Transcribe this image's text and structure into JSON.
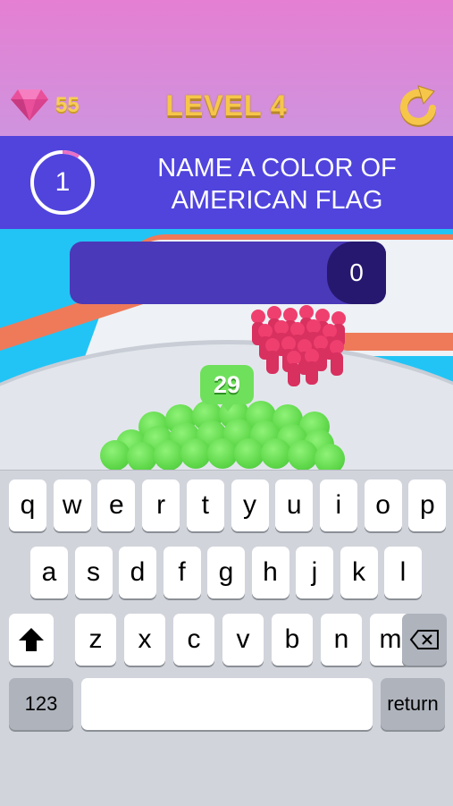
{
  "hud": {
    "gems": "55",
    "gem_icon": "diamond-gem-icon",
    "level": "LEVEL 4",
    "restart_icon": "restart-arrow-icon"
  },
  "question": {
    "timer": "1",
    "text_line1": "NAME A COLOR OF",
    "text_line2": "AMERICAN FLAG"
  },
  "answer": {
    "value": "",
    "count": "0"
  },
  "crowd": {
    "count": "29"
  },
  "keyboard": {
    "row1": [
      "q",
      "w",
      "e",
      "r",
      "t",
      "y",
      "u",
      "i",
      "o",
      "p"
    ],
    "row2": [
      "a",
      "s",
      "d",
      "f",
      "g",
      "h",
      "j",
      "k",
      "l"
    ],
    "row3": [
      "z",
      "x",
      "c",
      "v",
      "b",
      "n",
      "m"
    ],
    "shift_icon": "shift-arrow-icon",
    "delete_icon": "backspace-icon",
    "numbers_label": "123",
    "return_label": "return"
  },
  "colors": {
    "banner": "#5044dd",
    "answer_box": "#4a39b8",
    "player": "#5fd84a",
    "enemy": "#ef3f6f",
    "gold": "#f6c64a"
  }
}
